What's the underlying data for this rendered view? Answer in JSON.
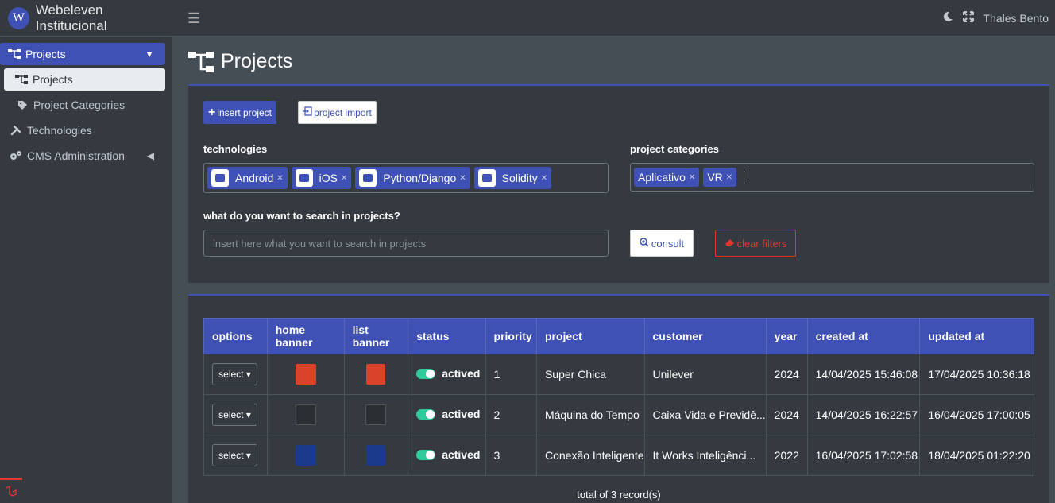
{
  "brand": {
    "logo_letter": "W",
    "name": "Webeleven Institucional"
  },
  "sidebar": {
    "items": [
      {
        "label": "Projects",
        "icon": "sitemap-icon"
      },
      {
        "label": "Projects",
        "icon": "sitemap-icon"
      },
      {
        "label": "Project Categories",
        "icon": "tag-icon"
      },
      {
        "label": "Technologies",
        "icon": "tools-icon"
      },
      {
        "label": "CMS Administration",
        "icon": "cogs-icon"
      }
    ]
  },
  "topbar": {
    "user": "Thales Bento"
  },
  "page": {
    "title": "Projects"
  },
  "toolbar": {
    "insert_label": "insert project",
    "import_label": "project import"
  },
  "filters": {
    "technologies_label": "technologies",
    "technologies": [
      "Android",
      "iOS",
      "Python/Django",
      "Solidity"
    ],
    "categories_label": "project categories",
    "categories": [
      "Aplicativo",
      "VR"
    ],
    "search_label": "what do you want to search in projects?",
    "search_placeholder": "insert here what you want to search in projects",
    "consult_label": "consult",
    "clear_label": "clear filters"
  },
  "table": {
    "headers": [
      "options",
      "home banner",
      "list banner",
      "status",
      "priority",
      "project",
      "customer",
      "year",
      "created at",
      "updated at"
    ],
    "rows": [
      {
        "options": "select",
        "status": "actived",
        "priority": "1",
        "project": "Super Chica",
        "customer": "Unilever",
        "year": "2024",
        "created_at": "14/04/2025 15:46:08",
        "updated_at": "17/04/2025 10:36:18",
        "thumb_color": "#d9432a"
      },
      {
        "options": "select",
        "status": "actived",
        "priority": "2",
        "project": "Máquina do Tempo",
        "customer": "Caixa Vida e Previdê...",
        "year": "2024",
        "created_at": "14/04/2025 16:22:57",
        "updated_at": "16/04/2025 17:00:05",
        "thumb_color": "#2a2f33"
      },
      {
        "options": "select",
        "status": "actived",
        "priority": "3",
        "project": "Conexão Inteligente",
        "customer": "It Works Inteligênci...",
        "year": "2022",
        "created_at": "16/04/2025 17:02:58",
        "updated_at": "18/04/2025 01:22:20",
        "thumb_color": "#1b3a8c"
      }
    ],
    "total": "total of 3 record(s)"
  }
}
